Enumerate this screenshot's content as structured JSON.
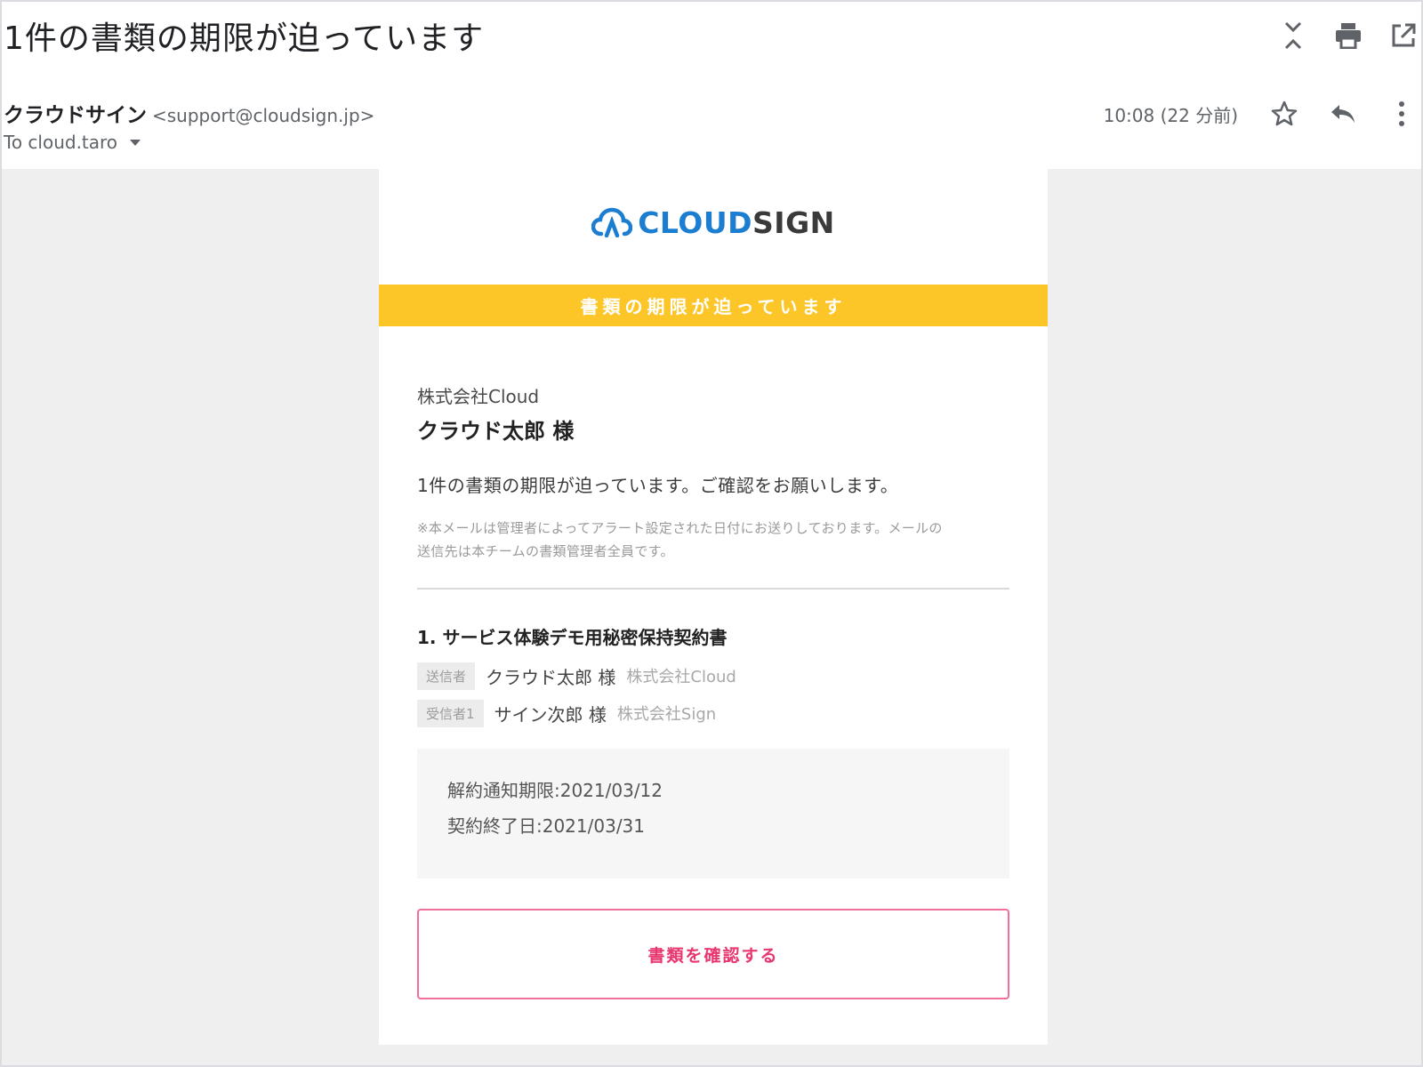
{
  "subject": "1件の書類の期限が迫っています",
  "toolbar": {
    "icons": [
      "expand-collapse-icon",
      "print-icon",
      "open-in-new-window-icon"
    ]
  },
  "sender": {
    "name": "クラウドサイン",
    "email": "<support@cloudsign.jp>",
    "to": "To cloud.taro",
    "timestamp": "10:08 (22 分前)",
    "icons": [
      "star-icon",
      "reply-icon",
      "more-vertical-icon"
    ]
  },
  "email": {
    "logo": {
      "part1": "CLOUD",
      "part2": "SIGN"
    },
    "banner": "書類の期限が迫っています",
    "company": "株式会社Cloud",
    "recipient": "クラウド太郎 様",
    "message": "1件の書類の期限が迫っています。ご確認をお願いします。",
    "note_line1": "※本メールは管理者によってアラート設定された日付にお送りしております。メールの",
    "note_line2": "送信先は本チームの書類管理者全員です。",
    "document": {
      "title": "1. サービス体験デモ用秘密保持契約書",
      "parties": [
        {
          "role": "送信者",
          "name": "クラウド太郎 様",
          "company": "株式会社Cloud"
        },
        {
          "role": "受信者1",
          "name": "サイン次郎 様",
          "company": "株式会社Sign"
        }
      ]
    },
    "dates": {
      "notice_deadline": "解約通知期限:2021/03/12",
      "contract_end": "契約終了日:2021/03/31"
    },
    "cta": "書類を確認する"
  },
  "colors": {
    "banner": "#fcc629",
    "brand_blue": "#1b7ed1",
    "cta_pink": "#e8366f"
  }
}
